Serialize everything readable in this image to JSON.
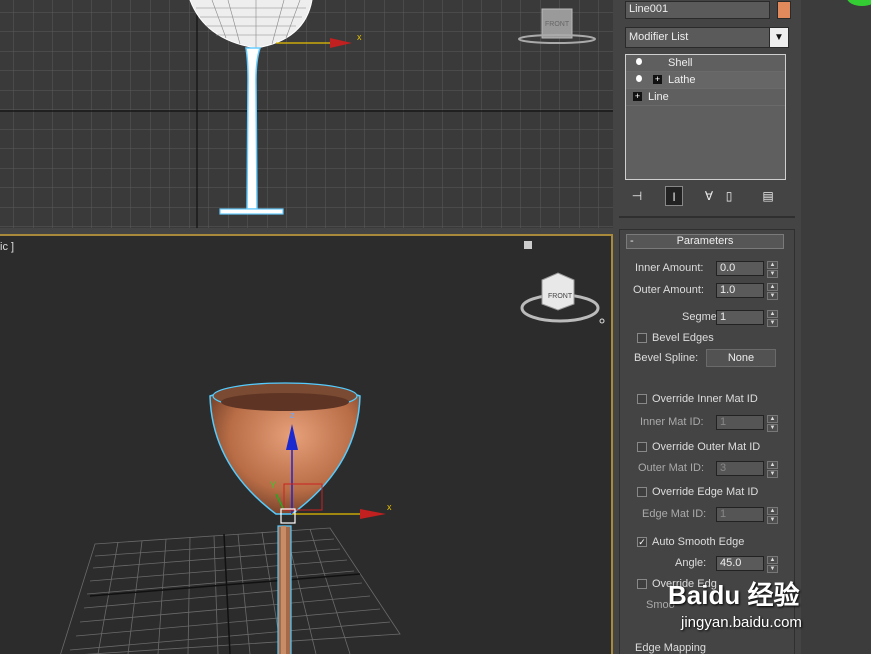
{
  "viewport_perspective": {
    "label": "ic ]"
  },
  "viewcube": {
    "front_label": "FRONT"
  },
  "gizmo": {
    "x_label": "x",
    "y_label": "Y",
    "z_label": "z"
  },
  "command_panel": {
    "object_name": "Line001",
    "object_color": "#e28a5b",
    "modifier_list": "Modifier List",
    "stack": [
      {
        "label": "Shell"
      },
      {
        "label": "Lathe"
      },
      {
        "label": "Line"
      }
    ],
    "rollout_title": "Parameters",
    "params": {
      "inner_amount_label": "Inner Amount:",
      "inner_amount": "0.0",
      "outer_amount_label": "Outer Amount:",
      "outer_amount": "1.0",
      "segments_label": "Segments:",
      "segments": "1",
      "bevel_edges_label": "Bevel Edges",
      "bevel_spline_label": "Bevel Spline:",
      "bevel_spline_button": "None",
      "override_inner_label": "Override Inner Mat ID",
      "inner_mat_label": "Inner Mat ID:",
      "inner_mat": "1",
      "override_outer_label": "Override Outer Mat ID",
      "outer_mat_label": "Outer Mat ID:",
      "outer_mat": "3",
      "override_edge_label": "Override Edge Mat ID",
      "edge_mat_label": "Edge Mat ID:",
      "edge_mat": "1",
      "auto_smooth_label": "Auto Smooth Edge",
      "angle_label": "Angle:",
      "angle": "45.0",
      "override_edge_smooth_label": "Override Edg",
      "smooth_label": "Smoo",
      "edge_mapping_label": "Edge Mapping"
    }
  },
  "watermark": {
    "brand": "Baidu 经验",
    "url": "jingyan.baidu.com"
  }
}
